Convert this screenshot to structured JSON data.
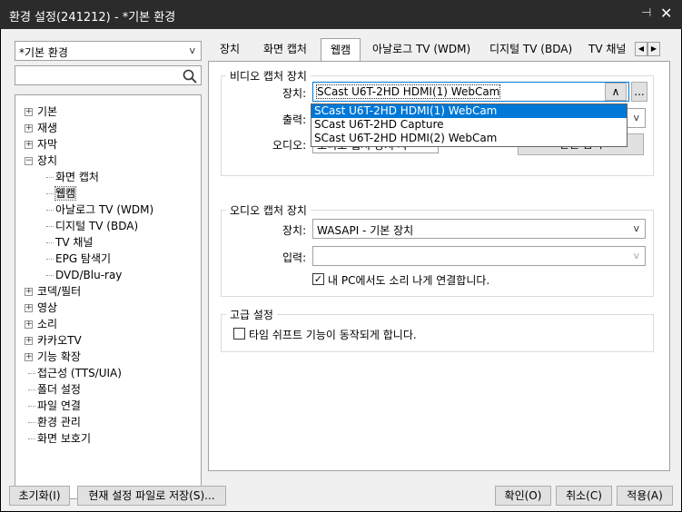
{
  "window": {
    "title": "환경 설정(241212) - *기본 환경",
    "pin_icon": "pin-icon",
    "close_icon": "close-icon"
  },
  "left": {
    "profile_combo": "*기본 환경",
    "search_placeholder": "",
    "tree": [
      {
        "label": "기본",
        "expander": "+"
      },
      {
        "label": "재생",
        "expander": "+"
      },
      {
        "label": "자막",
        "expander": "+"
      },
      {
        "label": "장치",
        "expander": "−"
      },
      {
        "label": "화면 캡처"
      },
      {
        "label": "웹캠",
        "selected": true
      },
      {
        "label": "아날로그 TV (WDM)"
      },
      {
        "label": "디지털 TV (BDA)"
      },
      {
        "label": "TV 채널"
      },
      {
        "label": "EPG 탐색기"
      },
      {
        "label": "DVD/Blu-ray"
      },
      {
        "label": "코덱/필터",
        "expander": "+"
      },
      {
        "label": "영상",
        "expander": "+"
      },
      {
        "label": "소리",
        "expander": "+"
      },
      {
        "label": "카카오TV",
        "expander": "+"
      },
      {
        "label": "기능 확장",
        "expander": "+"
      },
      {
        "label": "접근성 (TTS/UIA)"
      },
      {
        "label": "폴더 설정"
      },
      {
        "label": "파일 연결"
      },
      {
        "label": "환경 관리"
      },
      {
        "label": "화면 보호기"
      }
    ]
  },
  "tabs": [
    "장치",
    "화면 캡처",
    "웹캠",
    "아날로그 TV (WDM)",
    "디지털 TV (BDA)",
    "TV 채널"
  ],
  "active_tab": "웹캠",
  "video_group": {
    "title": "비디오 캡처 장치",
    "device_label": "장치:",
    "device_value": "SCast U6T-2HD HDMI(1) WebCam",
    "device_more": "...",
    "output_label": "출력:",
    "audio_label": "오디오:",
    "audio_value_partial": "오디오 캡처 장치 사",
    "dropdown_options": [
      "SCast U6T-2HD HDMI(1) WebCam",
      "SCast U6T-2HD Capture",
      "SCast U6T-2HD HDMI(2) WebCam"
    ],
    "hidden_button_partial": "연결 검색"
  },
  "audio_group": {
    "title": "오디오 캡처 장치",
    "device_label": "장치:",
    "device_value": "WASAPI - 기본 장치",
    "input_label": "입력:",
    "input_value": "",
    "connect_checkbox_label": "내 PC에서도 소리 나게 연결합니다.",
    "connect_checked": true
  },
  "advanced_group": {
    "title": "고급 설정",
    "timeshift_label": "타임 쉬프트 기능이 동작되게 합니다.",
    "timeshift_checked": false
  },
  "footer": {
    "reset": "초기화(I)",
    "save_file": "현재 설정 파일로 저장(S)...",
    "ok": "확인(O)",
    "cancel": "취소(C)",
    "apply": "적용(A)"
  }
}
